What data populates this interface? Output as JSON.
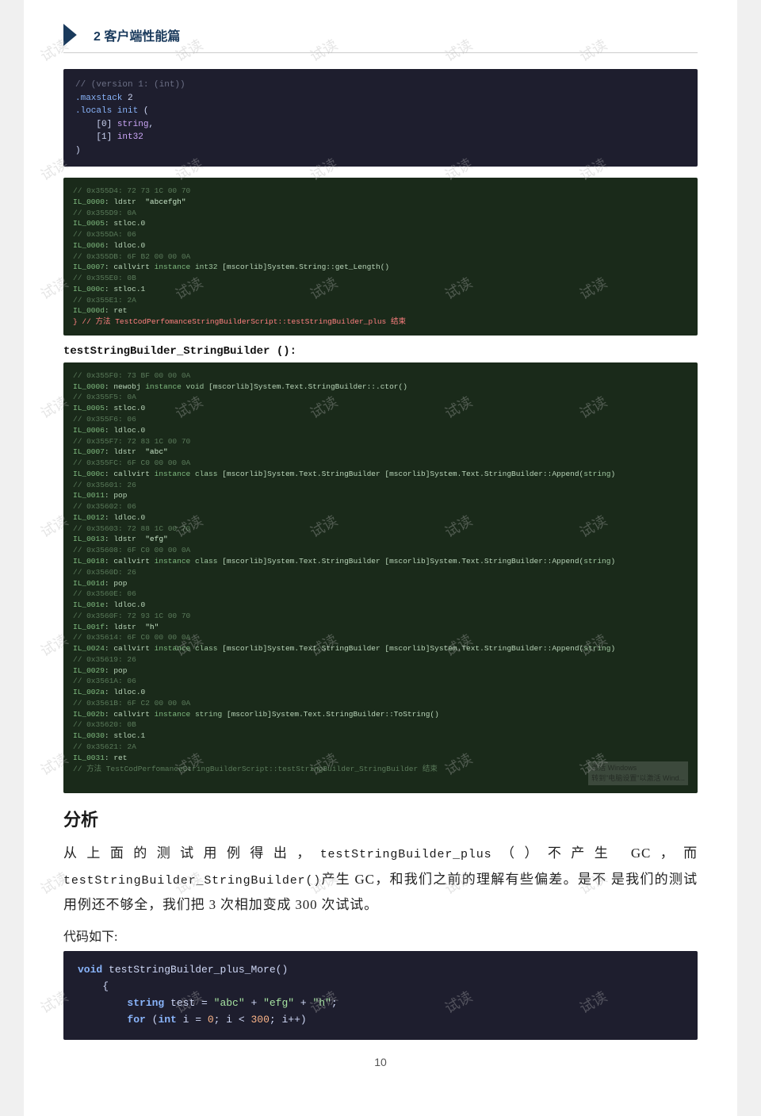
{
  "chapter": {
    "number": "2",
    "title": "2 客户端性能篇"
  },
  "code_block_1": {
    "lines": [
      "// (version 1: (int))",
      ".maxstack 2",
      ".locals init (",
      "    [0] string,",
      "    [1] int32",
      ")"
    ]
  },
  "il_block_1": {
    "lines": [
      "// 0x355D4: 72 73 1C 00 70",
      "IL_0000: ldstr  \"abcefgh\"",
      "// 0x355D9: 0A",
      "IL_0005: stloc.0",
      "// 0x355DA: 06",
      "IL_0006: ldloc.0",
      "// 0x355DB: 6F B2 00 00 0A",
      "IL_0007: callvirt instance int32 [mscorlib]System.String::get_Length()",
      "// 0x355E0: 0B",
      "IL_000c: stloc.1",
      "// 0x355E1: 2A",
      "IL_000d: ret",
      "} // 方法 TestCodPerfomanceStringBuilderScript::testStringBuilder_plus 结束"
    ]
  },
  "method_title_2": "testStringBuilder_StringBuilder ():",
  "il_block_2": {
    "lines": [
      "// 0x355F0: 73 BF 00 00 0A",
      "IL_0000: newobj instance void [mscorlib]System.Text.StringBuilder::.ctor()",
      "// 0x355F5: 0A",
      "IL_0005: stloc.0",
      "// 0x355F6: 06",
      "IL_0006: ldloc.0",
      "// 0x355F7: 72 83 1C 00 70",
      "IL_0007: ldstr  \"abc\"",
      "// 0x355FC: 6F C0 00 00 0A",
      "IL_000c: callvirt instance class [mscorlib]System.Text.StringBuilder [mscorlib]System.Text.StringBuilder::Append(string)",
      "// 0x35601: 26",
      "IL_0011: pop",
      "// 0x35602: 06",
      "IL_0012: ldloc.0",
      "// 0x35603: 72 88 1C 00 70",
      "IL_0013: ldstr  \"efg\"",
      "// 0x35608: 6F C0 00 00 0A",
      "IL_0018: callvirt instance class [mscorlib]System.Text.StringBuilder [mscorlib]System.Text.StringBuilder::Append(string)",
      "// 0x3560D: 26",
      "IL_001d: pop",
      "// 0x3560E: 06",
      "IL_001e: ldloc.0",
      "// 0x3560F: 72 93 1C 00 70",
      "IL_001f: ldstr  \"h\"",
      "// 0x35614: 6F C0 00 00 0A",
      "IL_0024: callvirt instance class [mscorlib]System.Text.StringBuilder [mscorlib]System.Text.StringBuilder::Append(string)",
      "// 0x35619: 26",
      "IL_0029: pop",
      "// 0x3561A: 06",
      "IL_002a: ldloc.0",
      "// 0x3561B: 6F C2 00 00 0A",
      "IL_002b: callvirt instance string [mscorlib]System.Text.StringBuilder::ToString()",
      "// 0x35620: 0B",
      "IL_0030: stloc.1",
      "// 0x35621: 2A",
      "IL_0031: ret",
      "// 方法 TestCodPerfomanceStringBuilderScript::testStringBuilder_StringBuilder 结束"
    ]
  },
  "section": {
    "heading": "分析",
    "body1": "从上面的测试用例得出，testStringBuilder_plus（）不产生 GC，而testStringBuilder_StringBuilder()产生 GC，和我们之前的理解有些偏差。是不是我们的测试用例还不够全，我们把 3 次相加变成 300 次试试。",
    "code_label": "代码如下:",
    "code_method": "void testStringBuilder_plus_More()",
    "code_brace": "    {",
    "code_line1": "        string test = \"abc\" + \"efg\" + \"h\";",
    "code_line2": "        for (int i = 0; i < 300; i++)"
  },
  "page_number": "10",
  "windows_activate": "激活 Windows\n转到\"电脑设置\"以激活 Wind..."
}
